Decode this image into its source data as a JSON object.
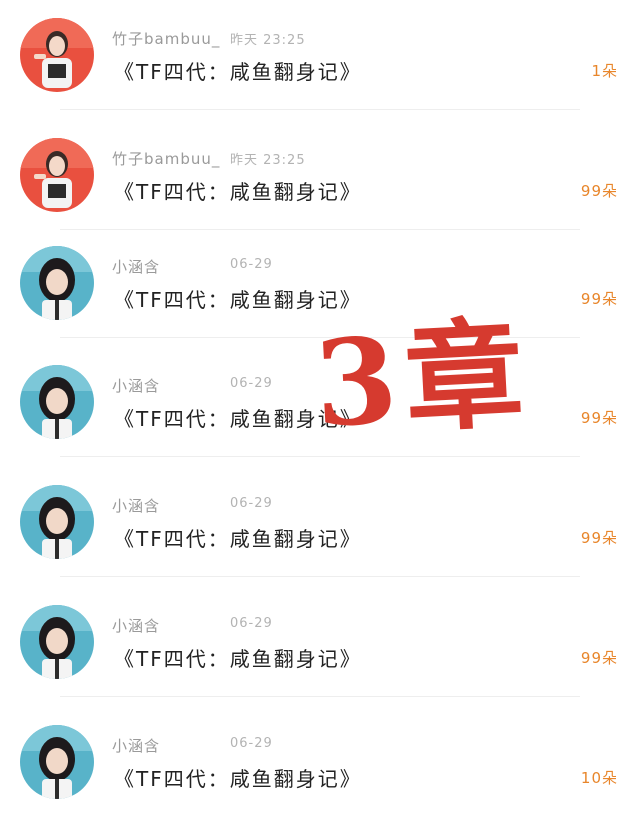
{
  "messages": [
    {
      "user": "竹子bambuu_",
      "time": "昨天 23:25",
      "title": "《TF四代：咸鱼翻身记》",
      "count": "1朵",
      "avatar": "avatar-girl-red-icon"
    },
    {
      "user": "竹子bambuu_",
      "time": "昨天 23:25",
      "title": "《TF四代：咸鱼翻身记》",
      "count": "99朵",
      "avatar": "avatar-girl-red-icon"
    },
    {
      "user": "小涵含",
      "time": "06-29",
      "title": "《TF四代：咸鱼翻身记》",
      "count": "99朵",
      "avatar": "avatar-girl-blue-icon"
    },
    {
      "user": "小涵含",
      "time": "06-29",
      "title": "《TF四代：咸鱼翻身记》",
      "count": "99朵",
      "avatar": "avatar-girl-blue-icon"
    },
    {
      "user": "小涵含",
      "time": "06-29",
      "title": "《TF四代：咸鱼翻身记》",
      "count": "99朵",
      "avatar": "avatar-girl-blue-icon"
    },
    {
      "user": "小涵含",
      "time": "06-29",
      "title": "《TF四代：咸鱼翻身记》",
      "count": "99朵",
      "avatar": "avatar-girl-blue-icon"
    },
    {
      "user": "小涵含",
      "time": "06-29",
      "title": "《TF四代：咸鱼翻身记》",
      "count": "10朵",
      "avatar": "avatar-girl-blue-icon"
    }
  ],
  "overlay_text": "3章",
  "colors": {
    "count": "#e8862b",
    "overlay": "#d63a2f",
    "username": "#9a9a9a"
  }
}
